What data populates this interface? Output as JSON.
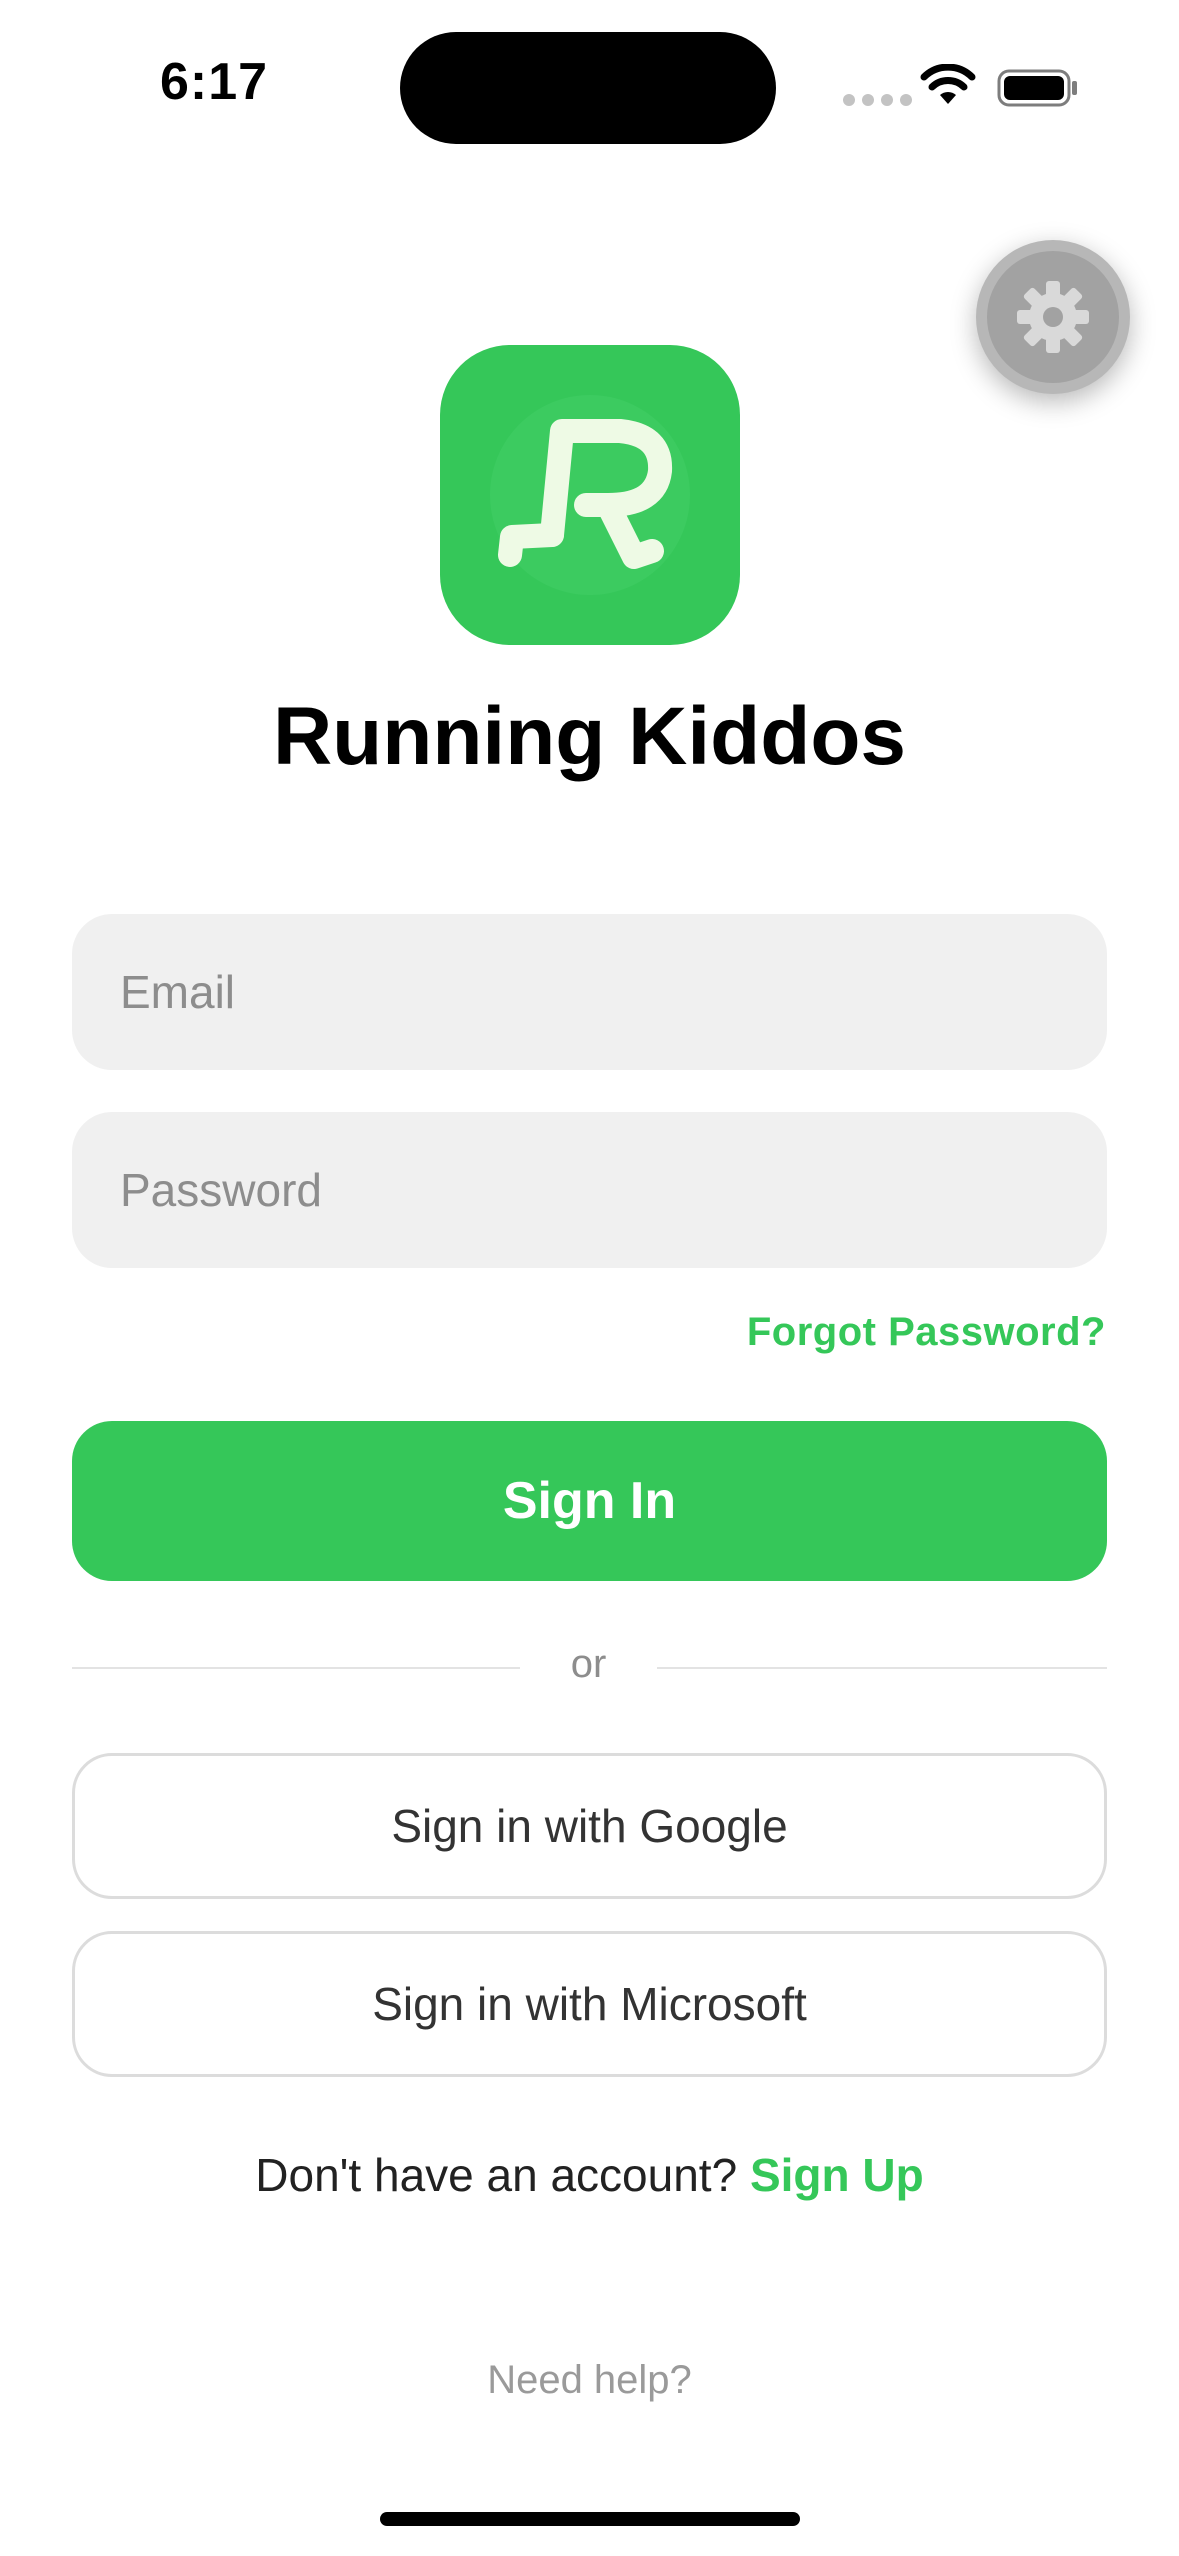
{
  "status_bar": {
    "time": "6:17",
    "icons": [
      "cellular-signal-icon",
      "wifi-icon",
      "battery-icon"
    ]
  },
  "settings": {
    "icon": "gear-icon"
  },
  "app": {
    "logo_icon": "running-r-logo-icon",
    "title": "Running Kiddos"
  },
  "login_form": {
    "email_placeholder": "Email",
    "email_value": "",
    "password_placeholder": "Password",
    "password_value": "",
    "forgot_password_label": "Forgot Password?",
    "sign_in_label": "Sign In"
  },
  "divider": {
    "label": "or"
  },
  "social": {
    "google_label": "Sign in with Google",
    "microsoft_label": "Sign in with Microsoft"
  },
  "footer": {
    "no_account_text": "Don't have an account?",
    "sign_up_label": "Sign Up",
    "help_label": "Need help?"
  },
  "colors": {
    "accent": "#35c759",
    "field_background": "#f0f0f0",
    "placeholder": "#8d8d8d",
    "settings_button": "#a2a2a2"
  }
}
